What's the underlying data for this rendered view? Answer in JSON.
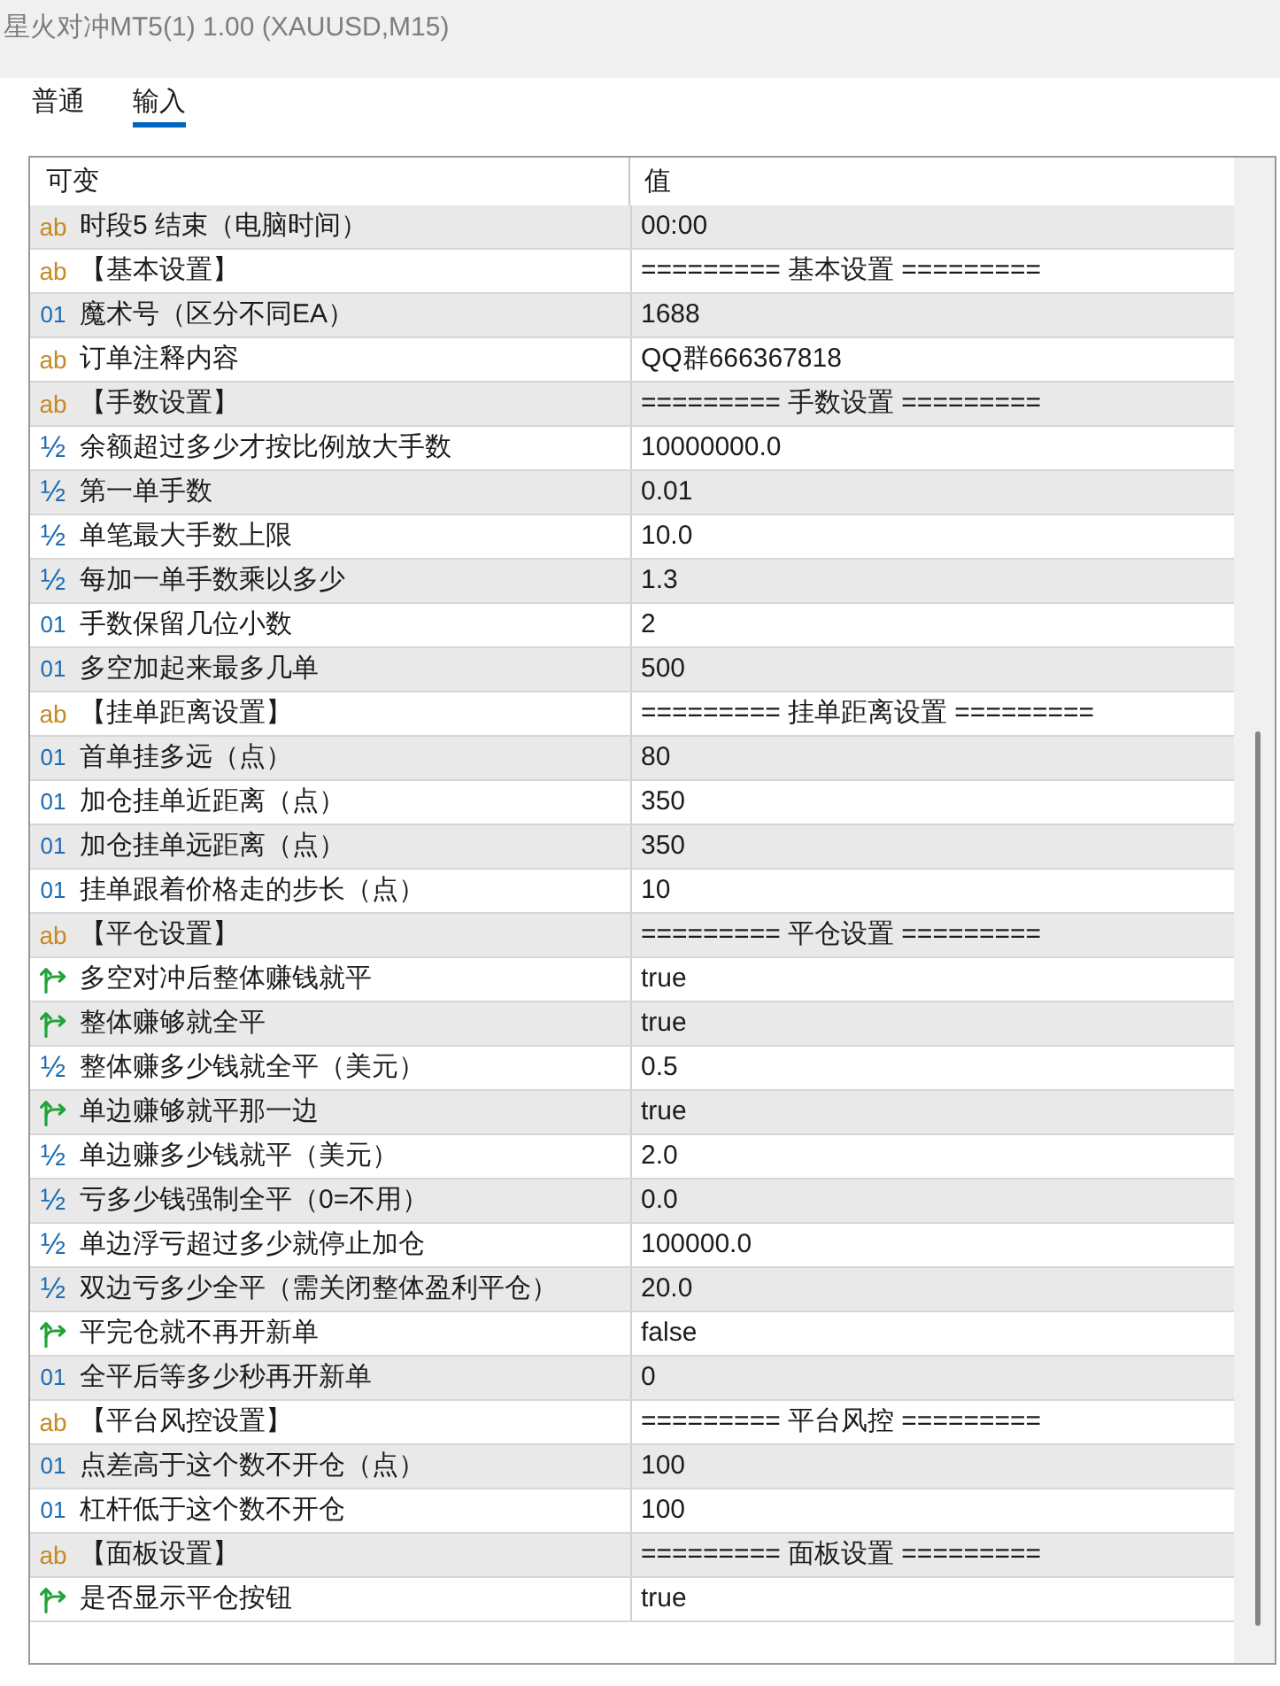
{
  "window": {
    "title": "星火对冲MT5(1) 1.00 (XAUUSD,M15)"
  },
  "tabs": [
    {
      "label": "普通",
      "selected": false
    },
    {
      "label": "输入",
      "selected": true
    }
  ],
  "table": {
    "columns": [
      "可变",
      "值"
    ],
    "rows": [
      {
        "kind": "string",
        "icon": "ab",
        "name": "时段5 结束（电脑时间）",
        "value": "00:00"
      },
      {
        "kind": "string",
        "icon": "ab",
        "name": "【基本设置】",
        "value": "========= 基本设置 ========="
      },
      {
        "kind": "int",
        "icon": "01",
        "name": "魔术号（区分不同EA）",
        "value": "1688"
      },
      {
        "kind": "string",
        "icon": "ab",
        "name": "订单注释内容",
        "value": "QQ群666367818"
      },
      {
        "kind": "string",
        "icon": "ab",
        "name": "【手数设置】",
        "value": "========= 手数设置 ========="
      },
      {
        "kind": "double",
        "icon": "½",
        "name": "余额超过多少才按比例放大手数",
        "value": "10000000.0"
      },
      {
        "kind": "double",
        "icon": "½",
        "name": "第一单手数",
        "value": "0.01"
      },
      {
        "kind": "double",
        "icon": "½",
        "name": "单笔最大手数上限",
        "value": "10.0"
      },
      {
        "kind": "double",
        "icon": "½",
        "name": "每加一单手数乘以多少",
        "value": "1.3"
      },
      {
        "kind": "int",
        "icon": "01",
        "name": "手数保留几位小数",
        "value": "2"
      },
      {
        "kind": "int",
        "icon": "01",
        "name": "多空加起来最多几单",
        "value": "500"
      },
      {
        "kind": "string",
        "icon": "ab",
        "name": "【挂单距离设置】",
        "value": "========= 挂单距离设置 ========="
      },
      {
        "kind": "int",
        "icon": "01",
        "name": "首单挂多远（点）",
        "value": "80"
      },
      {
        "kind": "int",
        "icon": "01",
        "name": "加仓挂单近距离（点）",
        "value": "350"
      },
      {
        "kind": "int",
        "icon": "01",
        "name": "加仓挂单远距离（点）",
        "value": "350"
      },
      {
        "kind": "int",
        "icon": "01",
        "name": "挂单跟着价格走的步长（点）",
        "value": "10"
      },
      {
        "kind": "string",
        "icon": "ab",
        "name": "【平仓设置】",
        "value": "========= 平仓设置 ========="
      },
      {
        "kind": "bool",
        "name": "多空对冲后整体赚钱就平",
        "value": "true"
      },
      {
        "kind": "bool",
        "name": "整体赚够就全平",
        "value": "true"
      },
      {
        "kind": "double",
        "icon": "½",
        "name": "整体赚多少钱就全平（美元）",
        "value": "0.5"
      },
      {
        "kind": "bool",
        "name": "单边赚够就平那一边",
        "value": "true"
      },
      {
        "kind": "double",
        "icon": "½",
        "name": "单边赚多少钱就平（美元）",
        "value": "2.0"
      },
      {
        "kind": "double",
        "icon": "½",
        "name": "亏多少钱强制全平（0=不用）",
        "value": "0.0"
      },
      {
        "kind": "double",
        "icon": "½",
        "name": "单边浮亏超过多少就停止加仓",
        "value": "100000.0"
      },
      {
        "kind": "double",
        "icon": "½",
        "name": "双边亏多少全平（需关闭整体盈利平仓）",
        "value": "20.0"
      },
      {
        "kind": "bool",
        "name": "平完仓就不再开新单",
        "value": "false"
      },
      {
        "kind": "int",
        "icon": "01",
        "name": "全平后等多少秒再开新单",
        "value": "0"
      },
      {
        "kind": "string",
        "icon": "ab",
        "name": "【平台风控设置】",
        "value": "========= 平台风控 ========="
      },
      {
        "kind": "int",
        "icon": "01",
        "name": "点差高于这个数不开仓（点）",
        "value": "100"
      },
      {
        "kind": "int",
        "icon": "01",
        "name": "杠杆低于这个数不开仓",
        "value": "100"
      },
      {
        "kind": "string",
        "icon": "ab",
        "name": "【面板设置】",
        "value": "========= 面板设置 ========="
      },
      {
        "kind": "bool",
        "name": "是否显示平仓按钮",
        "value": "true"
      }
    ]
  }
}
